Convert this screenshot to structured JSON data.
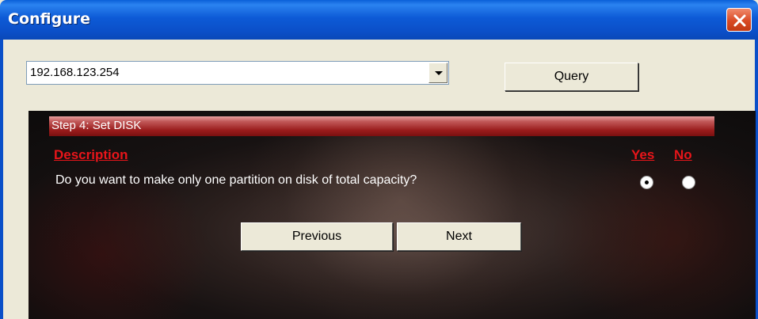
{
  "window": {
    "title": "Configure"
  },
  "address": {
    "value": "192.168.123.254"
  },
  "query_button": {
    "label": "Query"
  },
  "step": {
    "title": "Step 4: Set DISK"
  },
  "table": {
    "description_header": "Description",
    "yes_header": "Yes",
    "no_header": "No",
    "question": "Do you want to make only one partition on disk of total capacity?",
    "selected": "Yes"
  },
  "nav": {
    "previous_label": "Previous",
    "next_label": "Next"
  },
  "icons": {
    "close": "close-icon",
    "dropdown": "chevron-down-icon"
  },
  "colors": {
    "titlebar": "#0b4fc8",
    "header_red": "#e8151a",
    "step_bar": "#9a1c1c",
    "window_bg": "#ece9d8"
  }
}
